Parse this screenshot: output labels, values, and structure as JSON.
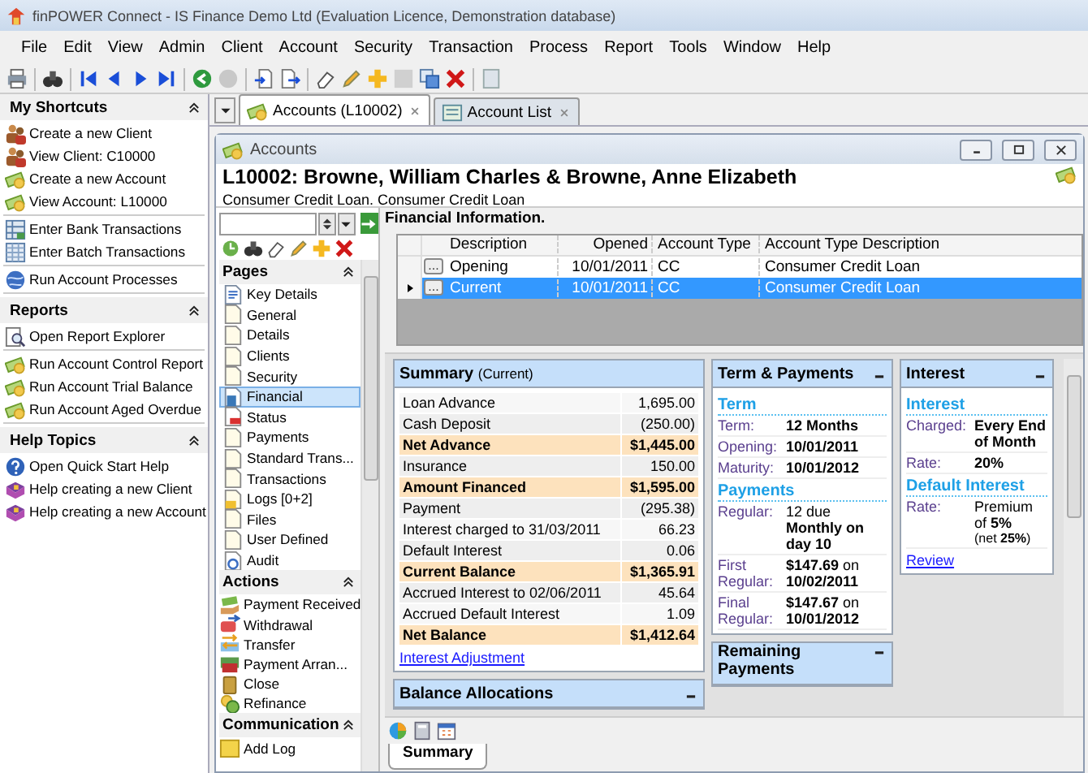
{
  "window": {
    "title": "finPOWER Connect - IS Finance Demo Ltd (Evaluation Licence, Demonstration database)"
  },
  "menu": [
    "File",
    "Edit",
    "View",
    "Admin",
    "Client",
    "Account",
    "Security",
    "Transaction",
    "Process",
    "Report",
    "Tools",
    "Window",
    "Help"
  ],
  "sidebar": {
    "sections": [
      {
        "title": "My Shortcuts",
        "expanded": true,
        "groups": [
          [
            {
              "label": "Create a new Client",
              "kind": "client"
            },
            {
              "label": "View Client: C10000",
              "kind": "client"
            },
            {
              "label": "Create a new Account",
              "kind": "account"
            },
            {
              "label": "View Account: L10000",
              "kind": "account"
            }
          ],
          [
            {
              "label": "Enter Bank Transactions",
              "kind": "bank"
            },
            {
              "label": "Enter Batch Transactions",
              "kind": "batch"
            }
          ],
          [
            {
              "label": "Run Account Processes",
              "kind": "process"
            }
          ]
        ]
      },
      {
        "title": "Reports",
        "expanded": true,
        "groups": [
          [
            {
              "label": "Open Report Explorer",
              "kind": "report"
            }
          ],
          [
            {
              "label": "Run Account Control Report",
              "kind": "account"
            },
            {
              "label": "Run Account Trial Balance",
              "kind": "account"
            },
            {
              "label": "Run Account Aged Overdue",
              "kind": "account"
            }
          ]
        ]
      },
      {
        "title": "Help Topics",
        "expanded": true,
        "groups": [
          [
            {
              "label": "Open Quick Start Help",
              "kind": "help"
            },
            {
              "label": "Help creating a new Client",
              "kind": "book"
            },
            {
              "label": "Help creating a new Account",
              "kind": "book"
            }
          ]
        ]
      }
    ]
  },
  "document_tabs": [
    {
      "label": "Accounts (L10002)",
      "kind": "account",
      "selected": true
    },
    {
      "label": "Account List",
      "kind": "list",
      "selected": false
    }
  ],
  "account_window": {
    "title": "Accounts",
    "heading": "L10002: Browne, William Charles & Browne, Anne Elizabeth",
    "subheading": "Consumer Credit Loan. Consumer Credit Loan"
  },
  "navigator": {
    "sections": [
      {
        "title": "Pages",
        "expanded": true,
        "items": [
          {
            "label": "Key Details",
            "kind": "form",
            "selected": false
          },
          {
            "label": "General",
            "kind": "page",
            "selected": false
          },
          {
            "label": "Details",
            "kind": "page",
            "selected": false
          },
          {
            "label": "Clients",
            "kind": "page",
            "selected": false
          },
          {
            "label": "Security",
            "kind": "page",
            "selected": false
          },
          {
            "label": "Financial",
            "kind": "calc",
            "selected": true
          },
          {
            "label": "Status",
            "kind": "status",
            "selected": false
          },
          {
            "label": "Payments",
            "kind": "page",
            "selected": false
          },
          {
            "label": "Standard Trans...",
            "kind": "page",
            "selected": false
          },
          {
            "label": "Transactions",
            "kind": "page",
            "selected": false
          },
          {
            "label": "Logs [0+2]",
            "kind": "log",
            "selected": false
          },
          {
            "label": "Files",
            "kind": "page",
            "selected": false
          },
          {
            "label": "User Defined",
            "kind": "page",
            "selected": false
          },
          {
            "label": "Audit",
            "kind": "audit",
            "selected": false
          }
        ]
      },
      {
        "title": "Actions",
        "expanded": true,
        "items": [
          {
            "label": "Payment Received",
            "kind": "payment"
          },
          {
            "label": "Withdrawal",
            "kind": "withdrawal"
          },
          {
            "label": "Transfer",
            "kind": "transfer"
          },
          {
            "label": "Payment Arran...",
            "kind": "arrangement"
          },
          {
            "label": "Close",
            "kind": "close"
          },
          {
            "label": "Refinance",
            "kind": "refinance"
          }
        ]
      },
      {
        "title": "Communication",
        "expanded": true,
        "items": [
          {
            "label": "Add Log",
            "kind": "note"
          }
        ]
      }
    ]
  },
  "financial": {
    "title": "Financial Information.",
    "columns": [
      "Description",
      "Opened",
      "Account Type",
      "Account Type Description"
    ],
    "rows": [
      {
        "button": "...",
        "cells": [
          "Opening",
          "10/01/2011",
          "CC",
          "Consumer Credit Loan"
        ],
        "selected": false
      },
      {
        "button": "...",
        "cells": [
          "Current",
          "10/01/2011",
          "CC",
          "Consumer Credit Loan"
        ],
        "selected": true
      }
    ]
  },
  "summary": {
    "title": "Summary",
    "subtitle": "(Current)",
    "rows": [
      {
        "label": "Loan Advance",
        "value": "1,695.00",
        "kind": "item"
      },
      {
        "label": "Cash Deposit",
        "value": "(250.00)",
        "kind": "item"
      },
      {
        "label": "Net Advance",
        "value": "$1,445.00",
        "kind": "total"
      },
      {
        "label": "Insurance",
        "value": "150.00",
        "kind": "item"
      },
      {
        "label": "Amount Financed",
        "value": "$1,595.00",
        "kind": "total"
      },
      {
        "label": "Payment",
        "value": "(295.38)",
        "kind": "item"
      },
      {
        "label": "Interest charged to 31/03/2011",
        "value": "66.23",
        "kind": "item"
      },
      {
        "label": "Default Interest",
        "value": "0.06",
        "kind": "item"
      },
      {
        "label": "Current Balance",
        "value": "$1,365.91",
        "kind": "total"
      },
      {
        "label": "Accrued Interest to 02/06/2011",
        "value": "45.64",
        "kind": "item"
      },
      {
        "label": "Accrued Default Interest",
        "value": "1.09",
        "kind": "item"
      },
      {
        "label": "Net Balance",
        "value": "$1,412.64",
        "kind": "total"
      }
    ],
    "link": "Interest Adjustment"
  },
  "balance_allocations": {
    "title": "Balance Allocations"
  },
  "term_payments": {
    "title": "Term & Payments",
    "sections": [
      {
        "heading": "Term",
        "rows": [
          {
            "label": "Term:",
            "value": "12 Months",
            "kind": "strong"
          },
          {
            "label": "Opening:",
            "value": "10/01/2011",
            "kind": "strong"
          },
          {
            "label": "Maturity:",
            "value": "10/01/2012",
            "kind": "strong"
          }
        ]
      },
      {
        "heading": "Payments",
        "rows": [
          {
            "label": "Regular:",
            "value": "12 due **Monthly on day 10**",
            "kind": "mixed"
          },
          {
            "label": "First Regular:",
            "value": "**$147.69** on **10/02/2011**",
            "kind": "mixed"
          },
          {
            "label": "Final Regular:",
            "value": "**$147.67** on **10/01/2012**",
            "kind": "mixed"
          }
        ]
      }
    ]
  },
  "remaining_payments": {
    "title": "Remaining Payments"
  },
  "interest": {
    "title": "Interest",
    "sections": [
      {
        "heading": "Interest",
        "rows": [
          {
            "label": "Charged:",
            "value": "Every End of Month",
            "kind": "strong"
          },
          {
            "label": "Rate:",
            "value": "20%",
            "kind": "strong"
          }
        ]
      },
      {
        "heading": "Default Interest",
        "rows": [
          {
            "label": "Rate:",
            "value": "Premium of **5%**",
            "note": "(net **25%**)",
            "kind": "mixed"
          }
        ]
      }
    ],
    "link": "Review"
  },
  "bottom_tabs": [
    {
      "label": "Summary",
      "selected": true
    }
  ]
}
